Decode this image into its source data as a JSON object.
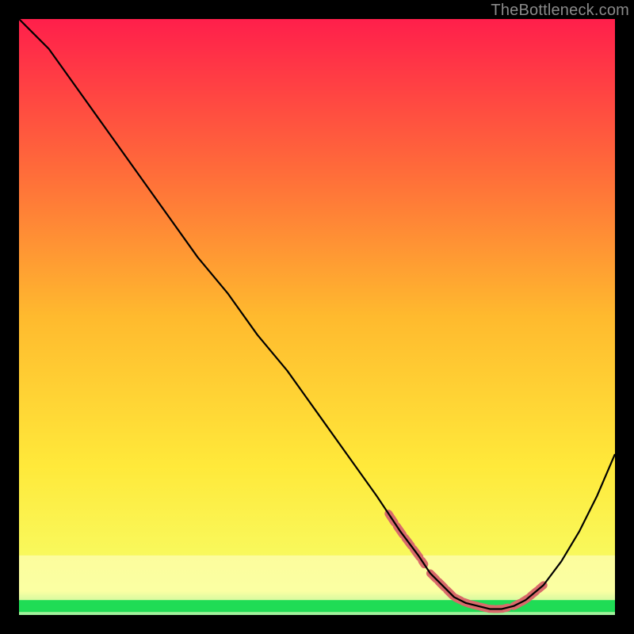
{
  "page": {
    "watermark": "TheBottleneck.com",
    "background_color": "#000000"
  },
  "chart_data": {
    "type": "line",
    "title": "",
    "xlabel": "",
    "ylabel": "",
    "xlim": [
      0,
      100
    ],
    "ylim": [
      0,
      100
    ],
    "x": [
      0,
      2,
      5,
      10,
      15,
      20,
      25,
      30,
      35,
      40,
      45,
      50,
      55,
      60,
      64,
      67,
      69,
      71,
      73,
      75,
      77,
      79,
      81,
      83,
      85,
      88,
      91,
      94,
      97,
      100
    ],
    "values": [
      100,
      98,
      95,
      88,
      81,
      74,
      67,
      60,
      54,
      47,
      41,
      34,
      27,
      20,
      14,
      10,
      7,
      5,
      3,
      2,
      1.5,
      1,
      1,
      1.5,
      2.5,
      5,
      9,
      14,
      20,
      27
    ],
    "gradient_stops": [
      {
        "offset": 0,
        "color": "#ff1f4b"
      },
      {
        "offset": 25,
        "color": "#ff6a3a"
      },
      {
        "offset": 50,
        "color": "#ffba2e"
      },
      {
        "offset": 75,
        "color": "#ffe93a"
      },
      {
        "offset": 96,
        "color": "#f6ff6a"
      },
      {
        "offset": 100,
        "color": "#25e05a"
      }
    ],
    "highlight_band": {
      "y_start": 90,
      "y_end": 100
    },
    "marker_ranges": [
      {
        "x_start": 62,
        "x_end": 68
      },
      {
        "x_start": 69,
        "x_end": 82
      },
      {
        "x_start": 83,
        "x_end": 88
      }
    ],
    "marker_color": "#d86a6a",
    "curve_color": "#000000",
    "curve_width": 2.2
  }
}
